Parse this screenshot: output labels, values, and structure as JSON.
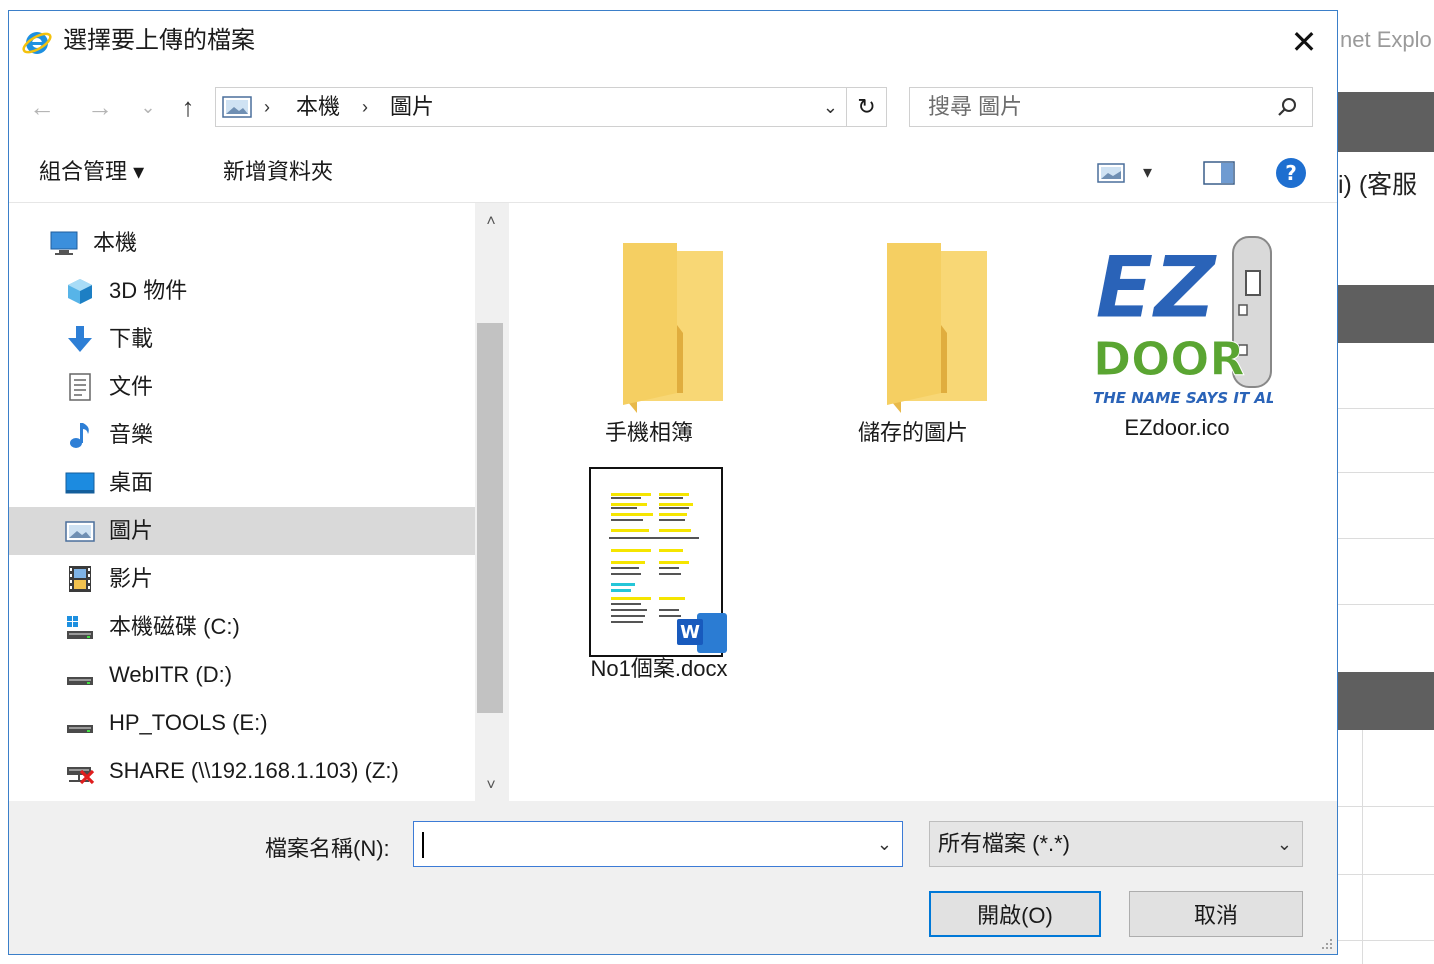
{
  "background_window": {
    "title_fragment": "net Explo",
    "text_fragment": "i) (客服"
  },
  "dialog": {
    "title": "選擇要上傳的檔案",
    "close_glyph": "✕"
  },
  "nav": {
    "back_glyph": "←",
    "forward_glyph": "→",
    "recent_glyph": "⌄",
    "up_glyph": "↑",
    "breadcrumb": [
      "本機",
      "圖片"
    ],
    "breadcrumb_sep": "›",
    "address_dropdown_glyph": "⌄",
    "refresh_glyph": "↻",
    "search_placeholder": "搜尋 圖片"
  },
  "toolbar": {
    "organize_label": "組合管理 ▾",
    "new_folder_label": "新增資料夾",
    "view_dropdown_glyph": "▾",
    "help_glyph": "?"
  },
  "sidebar": {
    "items": [
      {
        "label": "本機",
        "icon": "computer-icon"
      },
      {
        "label": "3D 物件",
        "icon": "cube-icon"
      },
      {
        "label": "下載",
        "icon": "download-arrow-icon"
      },
      {
        "label": "文件",
        "icon": "document-icon"
      },
      {
        "label": "音樂",
        "icon": "music-note-icon"
      },
      {
        "label": "桌面",
        "icon": "desktop-icon"
      },
      {
        "label": "圖片",
        "icon": "pictures-icon",
        "selected": true
      },
      {
        "label": "影片",
        "icon": "film-icon"
      },
      {
        "label": "本機磁碟 (C:)",
        "icon": "windows-drive-icon"
      },
      {
        "label": "WebITR (D:)",
        "icon": "drive-icon"
      },
      {
        "label": "HP_TOOLS (E:)",
        "icon": "drive-icon"
      },
      {
        "label": "SHARE (\\\\192.168.1.103) (Z:)",
        "icon": "disconnected-network-drive-icon"
      }
    ],
    "scroll_up_glyph": "˄",
    "scroll_down_glyph": "˅"
  },
  "files": [
    {
      "name": "手機相簿",
      "type": "folder"
    },
    {
      "name": "儲存的圖片",
      "type": "folder"
    },
    {
      "name": "EZdoor.ico",
      "type": "image",
      "thumb_text_main": "EZ",
      "thumb_text_sub": "DOOR",
      "thumb_tagline": "THE NAME SAYS IT ALL"
    },
    {
      "name": "No1個案.docx",
      "type": "word-document",
      "badge": "W"
    }
  ],
  "bottom": {
    "filename_label": "檔案名稱(N):",
    "filename_value": "",
    "filename_dropdown_glyph": "⌄",
    "filetype_value": "所有檔案 (*.*)",
    "filetype_dropdown_glyph": "⌄",
    "open_label": "開啟(O)",
    "cancel_label": "取消"
  },
  "colors": {
    "accent": "#0078d7",
    "selection": "#d9d9d9",
    "folder": "#f8d775",
    "folder_dark": "#e8b94a",
    "ez_blue": "#2a63b8",
    "ez_green": "#5aa532",
    "word_blue": "#185abd"
  }
}
